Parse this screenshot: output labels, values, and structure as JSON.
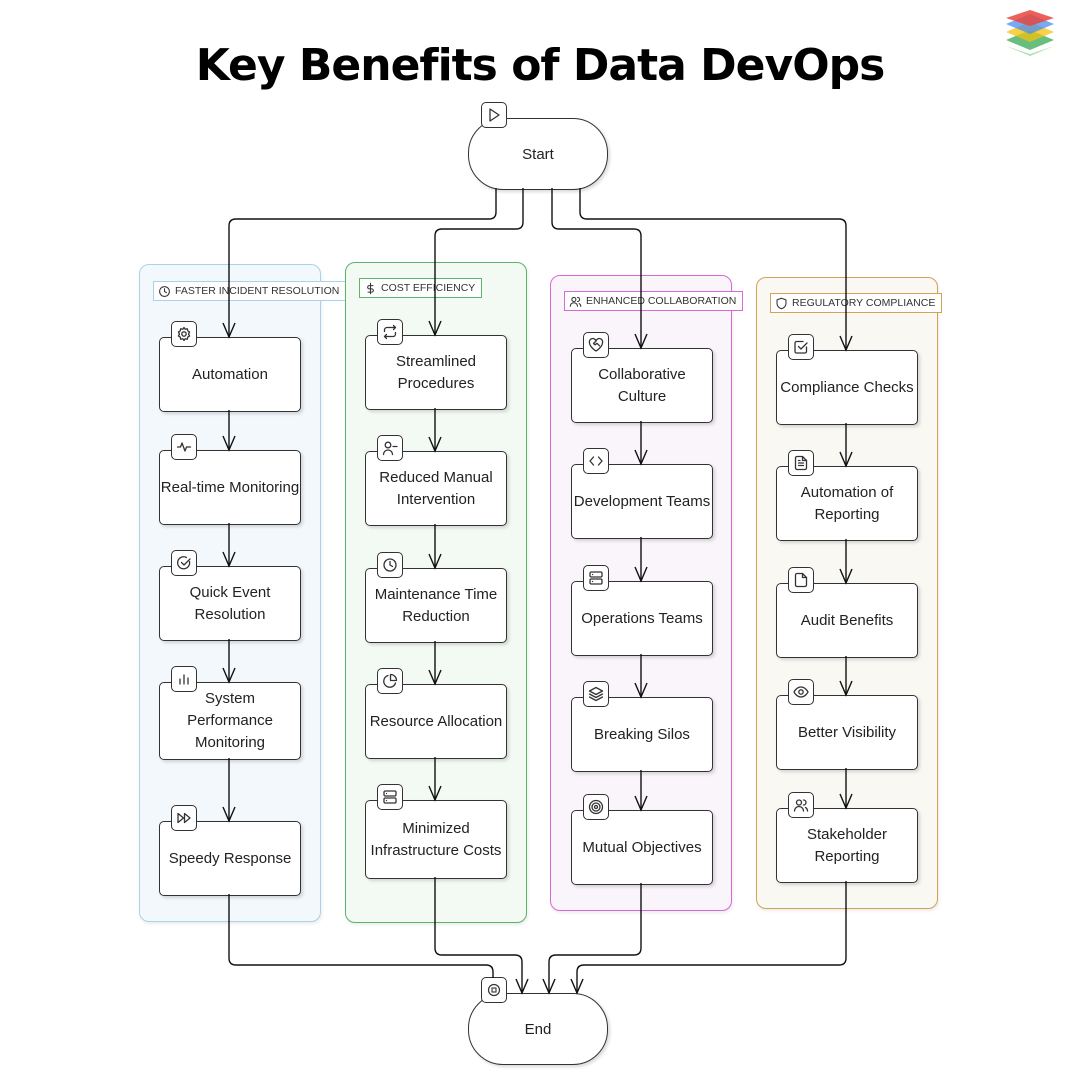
{
  "title": "Key Benefits of Data DevOps",
  "logo": {
    "name": "layers-logo",
    "colors": [
      "#e8453c",
      "#4a8cf0",
      "#f4c20d",
      "#34a853"
    ]
  },
  "start": {
    "label": "Start",
    "icon": "play-icon"
  },
  "end": {
    "label": "End",
    "icon": "stop-icon"
  },
  "lanes": [
    {
      "label": "FASTER INCIDENT RESOLUTION",
      "icon": "clock-icon",
      "border_color": "#a9d3e8",
      "fill_color": "#f3f8fc",
      "nodes": [
        {
          "label": "Automation",
          "icon": "gear-icon"
        },
        {
          "label": "Real-time Monitoring",
          "icon": "activity-icon"
        },
        {
          "label": "Quick Event Resolution",
          "icon": "check-circle-icon"
        },
        {
          "label": "System Performance Monitoring",
          "icon": "bar-chart-icon"
        },
        {
          "label": "Speedy Response",
          "icon": "fast-forward-icon"
        }
      ]
    },
    {
      "label": "COST EFFICIENCY",
      "icon": "dollar-icon",
      "border_color": "#5cb36a",
      "fill_color": "#f3faf4",
      "nodes": [
        {
          "label": "Streamlined Procedures",
          "icon": "repeat-icon"
        },
        {
          "label": "Reduced Manual Intervention",
          "icon": "user-minus-icon"
        },
        {
          "label": "Maintenance Time Reduction",
          "icon": "clock-icon"
        },
        {
          "label": "Resource Allocation",
          "icon": "pie-chart-icon"
        },
        {
          "label": "Minimized Infrastructure Costs",
          "icon": "server-icon"
        }
      ]
    },
    {
      "label": "ENHANCED COLLABORATION",
      "icon": "users-icon",
      "border_color": "#d66ad9",
      "fill_color": "#faf4fb",
      "nodes": [
        {
          "label": "Collaborative Culture",
          "icon": "handshake-heart-icon"
        },
        {
          "label": "Development Teams",
          "icon": "code-icon"
        },
        {
          "label": "Operations Teams",
          "icon": "server-icon"
        },
        {
          "label": "Breaking Silos",
          "icon": "layers-icon"
        },
        {
          "label": "Mutual Objectives",
          "icon": "target-icon"
        }
      ]
    },
    {
      "label": "REGULATORY COMPLIANCE",
      "icon": "shield-icon",
      "border_color": "#d4a257",
      "fill_color": "#faf8f3",
      "nodes": [
        {
          "label": "Compliance Checks",
          "icon": "check-square-icon"
        },
        {
          "label": "Automation of Reporting",
          "icon": "file-text-icon"
        },
        {
          "label": "Audit Benefits",
          "icon": "file-icon"
        },
        {
          "label": "Better Visibility",
          "icon": "eye-icon"
        },
        {
          "label": "Stakeholder Reporting",
          "icon": "users-icon"
        }
      ]
    }
  ]
}
